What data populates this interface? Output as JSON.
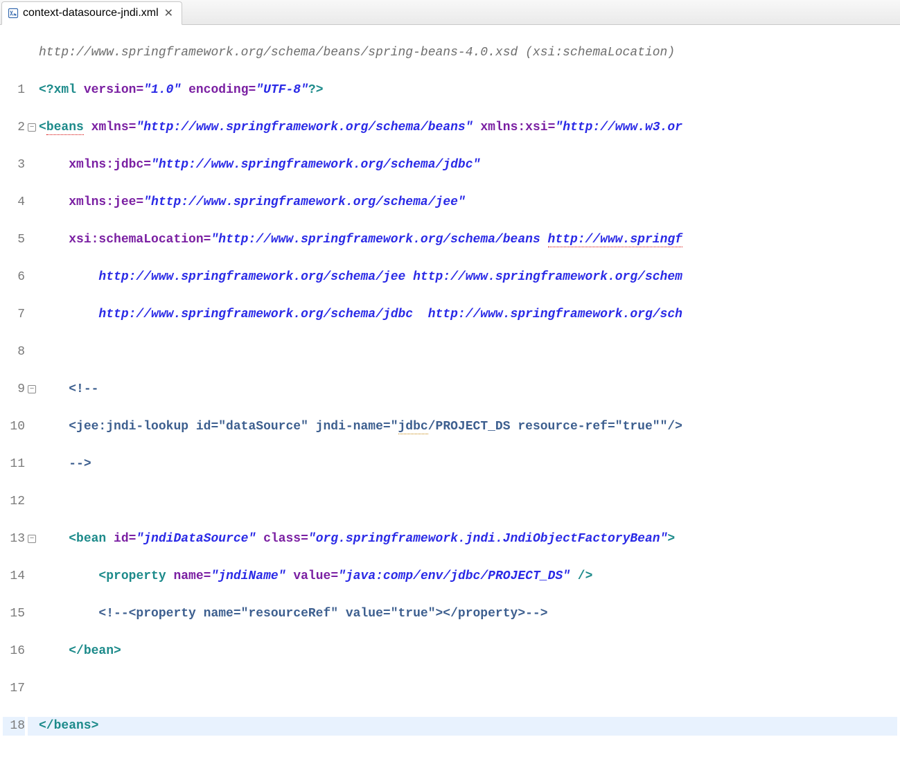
{
  "tab": {
    "filename": "context-datasource-jndi.xml"
  },
  "breadcrumb": "http://www.springframework.org/schema/beans/spring-beans-4.0.xsd (xsi:schemaLocation)",
  "gutter": {
    "1": "1",
    "2": "2",
    "3": "3",
    "4": "4",
    "5": "5",
    "6": "6",
    "7": "7",
    "8": "8",
    "9": "9",
    "10": "10",
    "11": "11",
    "12": "12",
    "13": "13",
    "14": "14",
    "15": "15",
    "16": "16",
    "17": "17",
    "18": "18"
  },
  "fold": {
    "minus": "−"
  },
  "code": {
    "l1": {
      "piOpen": "<?",
      "xml": "xml ",
      "verK": "version=",
      "verV": "\"1.0\"",
      "sp": " ",
      "encK": "encoding=",
      "encV": "\"UTF-8\"",
      "piClose": "?>"
    },
    "l2": {
      "lt": "<",
      "tag": "beans",
      "sp": " ",
      "a1": "xmlns=",
      "v1": "\"http://www.springframework.org/schema/beans\"",
      "sp2": " ",
      "a2": "xmlns:xsi=",
      "v2": "\"http://www.w3.or"
    },
    "l3": {
      "indent": "    ",
      "a": "xmlns:jdbc=",
      "v": "\"http://www.springframework.org/schema/jdbc\""
    },
    "l4": {
      "indent": "    ",
      "a": "xmlns:jee=",
      "v": "\"http://www.springframework.org/schema/jee\""
    },
    "l5": {
      "indent": "    ",
      "a": "xsi:schemaLocation=",
      "q": "\"",
      "v1": "http://www.springframework.org/schema/beans ",
      "v2": "http://www.springf"
    },
    "l6": {
      "indent": "        ",
      "v": "http://www.springframework.org/schema/jee http://www.springframework.org/schem"
    },
    "l7": {
      "indent": "        ",
      "v": "http://www.springframework.org/schema/jdbc  http://www.springframework.org/sch"
    },
    "l9": {
      "indent": "    ",
      "open": "<!--"
    },
    "l10": {
      "indent": "    ",
      "t1": "<jee:jndi-lookup id=\"dataSource\" jndi-name=\"",
      "warn": "jdbc",
      "t2": "/PROJECT_DS resource-ref=\"true\"\"/>"
    },
    "l11": {
      "indent": "    ",
      "close": "-->"
    },
    "l13": {
      "indent": "    ",
      "lt": "<",
      "tag": "bean ",
      "a1": "id=",
      "v1": "\"jndiDataSource\"",
      "sp": " ",
      "a2": "class=",
      "v2": "\"org.springframework.jndi.JndiObjectFactoryBean\"",
      "gt": ">"
    },
    "l14": {
      "indent": "        ",
      "lt": "<",
      "tag": "property ",
      "a1": "name=",
      "v1": "\"jndiName\"",
      "sp": " ",
      "a2": "value=",
      "v2": "\"java:comp/env/jdbc/PROJECT_DS\"",
      "end": " />"
    },
    "l15": {
      "indent": "        ",
      "c": "<!--<property name=\"resourceRef\" value=\"true\"></property>-->"
    },
    "l16": {
      "indent": "    ",
      "t": "</bean>"
    },
    "l18": {
      "t": "</beans>"
    }
  }
}
